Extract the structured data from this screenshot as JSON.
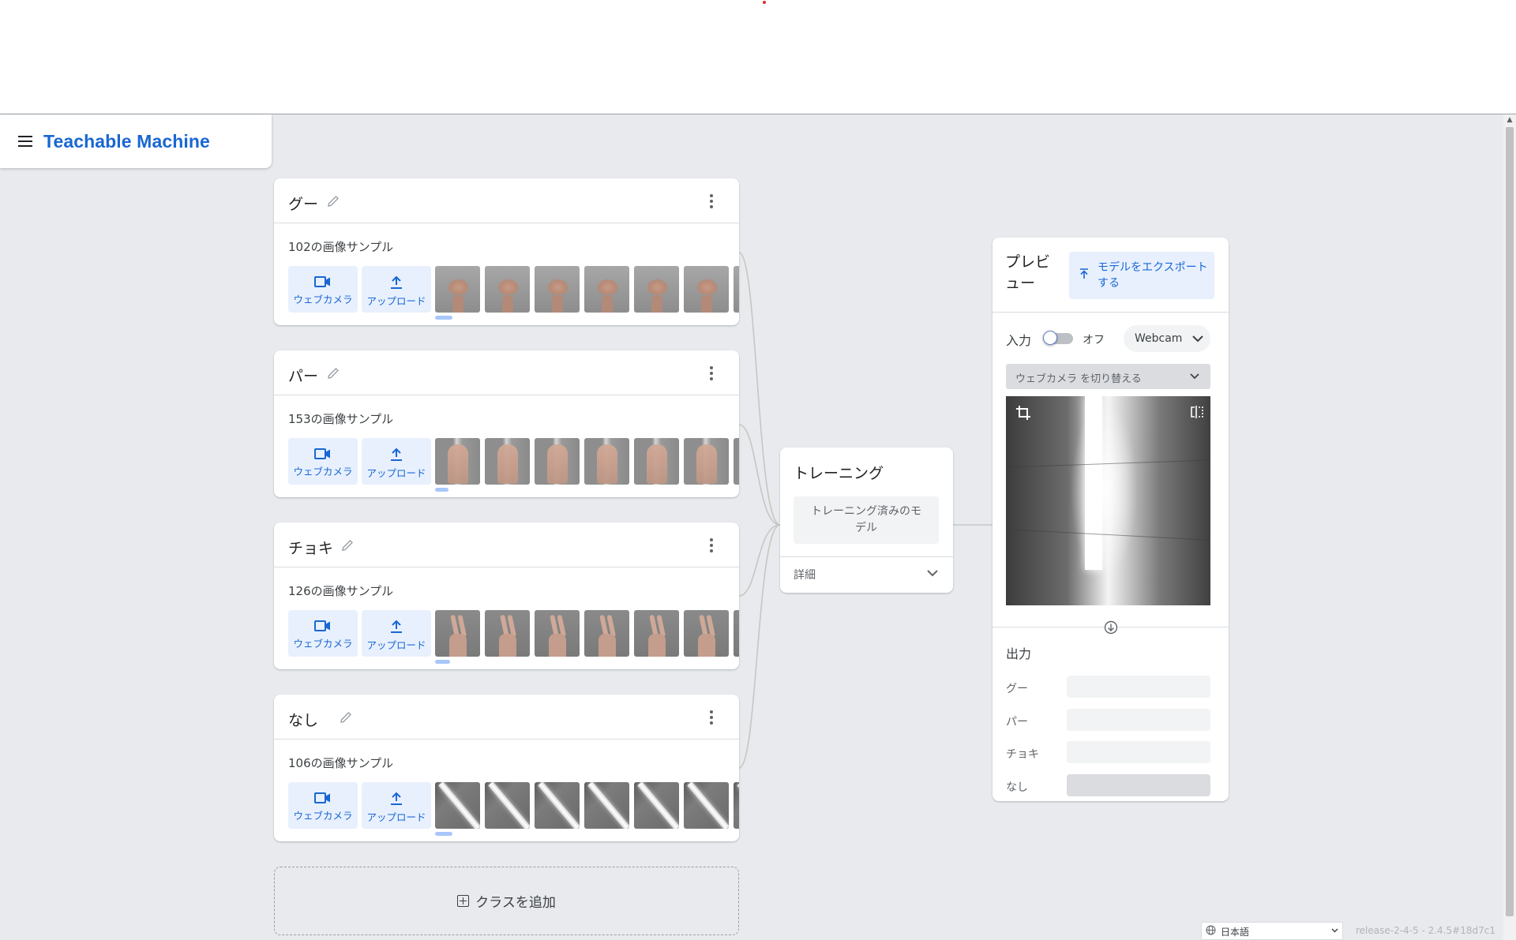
{
  "app": {
    "title": "Teachable Machine"
  },
  "classes": [
    {
      "name": "グー",
      "samples": "102の画像サンプル",
      "thumb_type": "fist"
    },
    {
      "name": "パー",
      "samples": "153の画像サンプル",
      "thumb_type": "palm"
    },
    {
      "name": "チョキ",
      "samples": "126の画像サンプル",
      "thumb_type": "peace"
    },
    {
      "name": "なし",
      "samples": "106の画像サンプル",
      "thumb_type": "light"
    }
  ],
  "source_buttons": {
    "webcam": "ウェブカメラ",
    "upload": "アップロード"
  },
  "add_class": "クラスを追加",
  "training": {
    "title": "トレーニング",
    "button": "トレーニング済みのモデル",
    "details": "詳細"
  },
  "preview": {
    "title": "プレビュー",
    "export": "モデルをエクスポートする",
    "input_label": "入力",
    "toggle_state": "オフ",
    "toggle_on": false,
    "source": "Webcam",
    "switch_camera": "ウェブカメラ を切り替える",
    "output_label": "出力",
    "outputs": [
      {
        "label": "グー",
        "confidence": 0
      },
      {
        "label": "パー",
        "confidence": 0
      },
      {
        "label": "チョキ",
        "confidence": 0
      },
      {
        "label": "なし",
        "confidence": 1
      }
    ]
  },
  "footer": {
    "language": "日本語",
    "release": "release-2-4-5 - 2.4.5#18d7c1"
  },
  "colors": {
    "accent": "#1967d2",
    "accent_bg": "#e8f0fe",
    "canvas": "#e8eaed"
  },
  "icons": [
    "menu-icon",
    "pencil-icon",
    "more-vert-icon",
    "videocam-icon",
    "upload-icon",
    "add-box-icon",
    "export-icon",
    "chevron-down-icon",
    "crop-icon",
    "flip-icon",
    "arrow-down-icon",
    "globe-icon"
  ]
}
